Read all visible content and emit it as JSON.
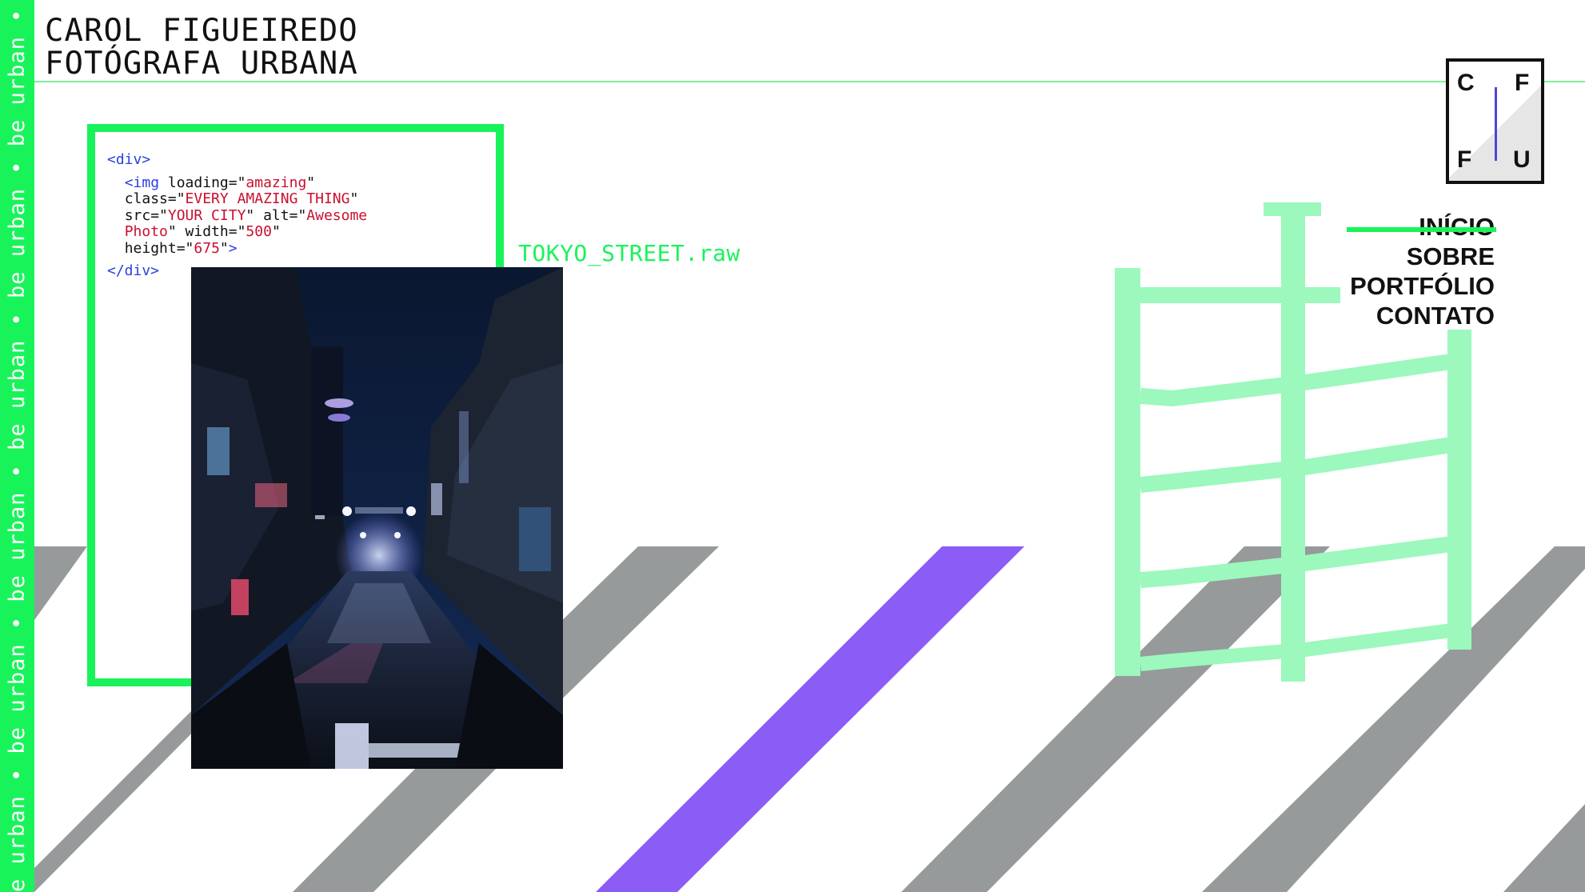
{
  "colors": {
    "accent_green": "#19f35a",
    "light_green": "#9cf8bd",
    "stripe_gray": "#969a9b",
    "stripe_purple": "#8b5cf6",
    "code_tag": "#2a3fe0",
    "code_string": "#c8102e"
  },
  "side_banner": {
    "text": "e urban • be urban • be urban • be urban • be urban • be urban • be urban • be ur"
  },
  "header": {
    "title_line1": "CAROL FIGUEIREDO",
    "title_line2": "FOTÓGRAFA URBANA"
  },
  "logo": {
    "tl": "C",
    "tr": "F",
    "bl": "F",
    "br": "U"
  },
  "nav": {
    "items": [
      {
        "label": "INÍCIO",
        "active": true
      },
      {
        "label": "SOBRE",
        "active": false
      },
      {
        "label": "PORTFÓLIO",
        "active": false
      },
      {
        "label": "CONTATO",
        "active": false
      }
    ]
  },
  "code_snippet": {
    "open_tag": "<div>",
    "img_open": "<img",
    "attr_loading": " loading=\"",
    "val_loading": "amazing",
    "attr_class": "class=\"",
    "val_class": "EVERY AMAZING THING",
    "attr_src": "src=\"",
    "val_src": "YOUR CITY",
    "attr_alt": "\" alt=\"",
    "val_alt_1": "Awesome",
    "val_alt_2": "Photo",
    "attr_width": "\" width=\"",
    "val_width": "500",
    "attr_height": "height=\"",
    "val_height": "675",
    "quote_close": "\"",
    "img_close": ">",
    "close_tag": "</div>"
  },
  "file_label": "TOKYO_STREET.raw",
  "photo": {
    "alt": "Tokyo street at night"
  }
}
